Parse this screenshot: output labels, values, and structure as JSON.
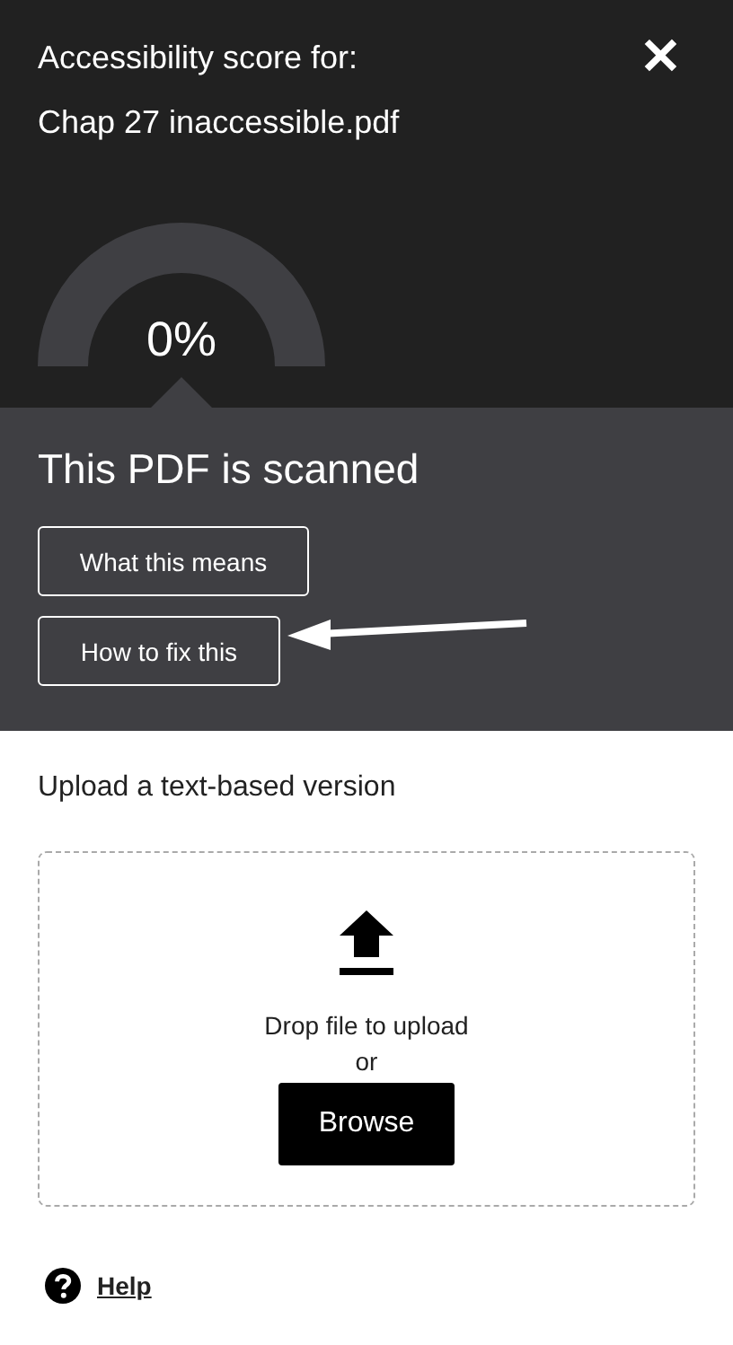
{
  "header": {
    "title": "Accessibility score for:",
    "filename": "Chap 27 inaccessible.pdf",
    "close": "✕"
  },
  "gauge": {
    "reading": "0%"
  },
  "status": {
    "heading": "This PDF is scanned",
    "buttons": [
      {
        "label": "What this means"
      },
      {
        "label": "How to fix this"
      }
    ]
  },
  "upload": {
    "heading": "Upload a text-based version",
    "drop_text": "Drop file to upload",
    "or_text": "or",
    "browse": "Browse"
  },
  "help": {
    "label": "Help"
  }
}
